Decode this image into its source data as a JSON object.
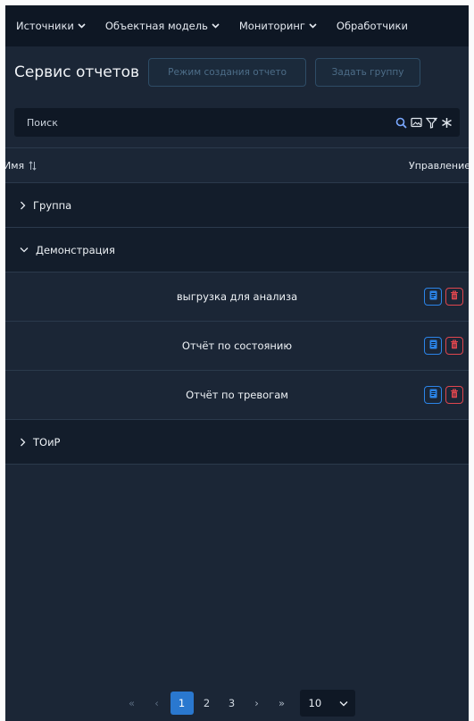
{
  "nav": {
    "items": [
      {
        "label": "Источники"
      },
      {
        "label": "Объектная модель"
      },
      {
        "label": "Мониторинг"
      },
      {
        "label": "Обработчики"
      }
    ]
  },
  "toolbar": {
    "title": "Сервис отчетов",
    "create_mode_label": "Режим создания отчето",
    "set_group_label": "Задать группу"
  },
  "search": {
    "placeholder": "Поиск",
    "value": ""
  },
  "table": {
    "col_name": "Имя",
    "col_actions": "Управление",
    "groups": [
      {
        "label": "Группа",
        "expanded": false
      },
      {
        "label": "Демонстрация",
        "expanded": true,
        "reports": [
          "выгрузка для анализа",
          "Отчёт по состоянию",
          "Отчёт по тревогам"
        ]
      },
      {
        "label": "ТОиР",
        "expanded": false
      }
    ]
  },
  "pagination": {
    "first": "«",
    "prev": "‹",
    "pages": [
      "1",
      "2",
      "3"
    ],
    "current": "1",
    "next": "›",
    "last": "»",
    "page_size": "10"
  },
  "colors": {
    "accent": "#2a78cf",
    "edit_icon": "#2b84e8",
    "delete_icon": "#e0464e"
  }
}
